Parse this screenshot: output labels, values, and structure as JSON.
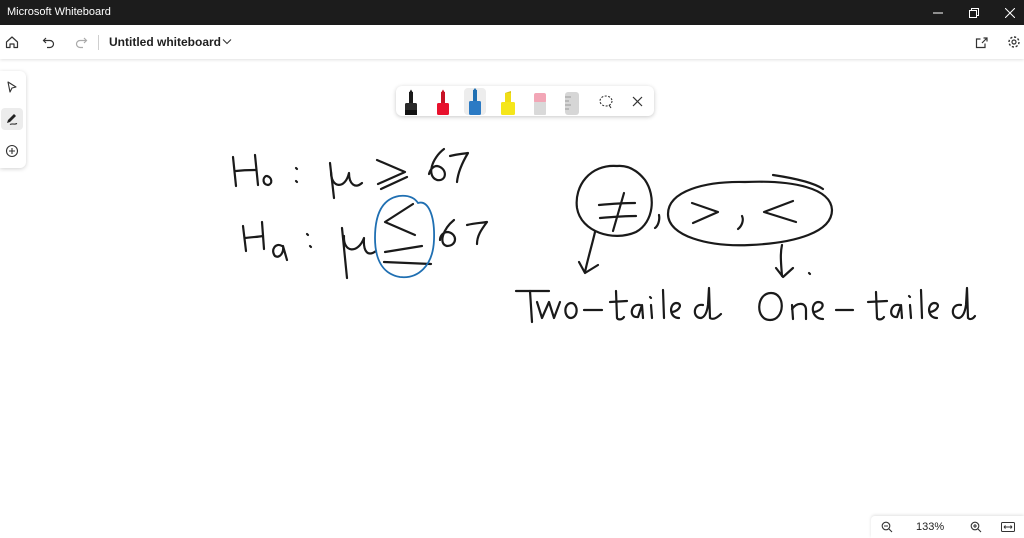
{
  "window": {
    "title": "Microsoft Whiteboard"
  },
  "appbar": {
    "document_title": "Untitled whiteboard"
  },
  "zoom": {
    "level": "133%"
  },
  "pens": [
    {
      "name": "black-pen",
      "color": "#1a1a1a"
    },
    {
      "name": "red-pen",
      "color": "#e8112d"
    },
    {
      "name": "blue-pen",
      "color": "#1f6fb2",
      "selected": true
    },
    {
      "name": "yellow-highlighter",
      "color": "#f5e61a"
    },
    {
      "name": "pink-highlighter",
      "color": "#f2a6b6"
    },
    {
      "name": "ruler",
      "color": "#c9c9c9"
    }
  ],
  "ink": {
    "line1": "H0 : μ ≥ 67",
    "line2": "Ha : μ ≤ 67",
    "circled_not_equal": "≠",
    "circled_greater_less": ">, <",
    "label_two_tailed": "Two-tailed",
    "label_one_tailed": "One-tailed"
  },
  "colors": {
    "ink": "#1a1a1a",
    "highlight_circle": "#1f6fb2",
    "titlebar": "#1c1c1c"
  }
}
